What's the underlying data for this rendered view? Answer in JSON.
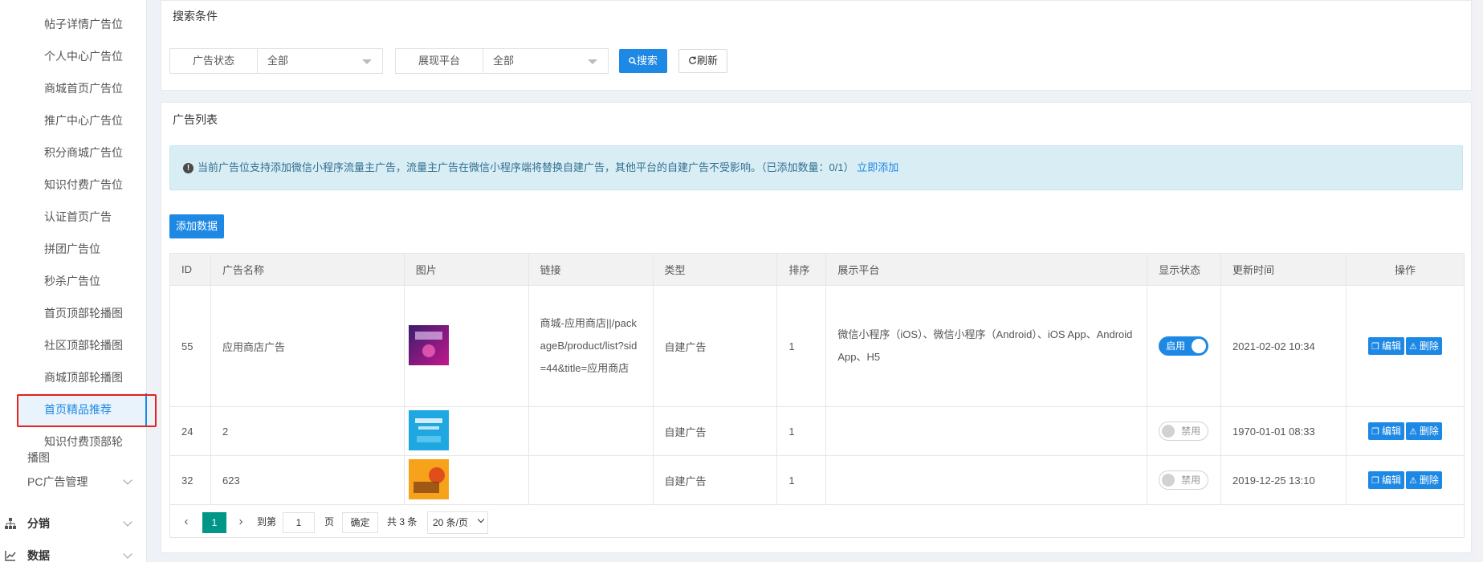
{
  "sidebar": {
    "items": [
      {
        "label": "帖子详情广告位"
      },
      {
        "label": "个人中心广告位"
      },
      {
        "label": "商城首页广告位"
      },
      {
        "label": "推广中心广告位"
      },
      {
        "label": "积分商城广告位"
      },
      {
        "label": "知识付费广告位"
      },
      {
        "label": "认证首页广告"
      },
      {
        "label": "拼团广告位"
      },
      {
        "label": "秒杀广告位"
      },
      {
        "label": "首页顶部轮播图"
      },
      {
        "label": "社区顶部轮播图"
      },
      {
        "label": "商城顶部轮播图"
      },
      {
        "label": "首页精品推荐",
        "active": true
      }
    ],
    "two_line_item": {
      "line1": "知识付费顶部轮",
      "line2": "播图"
    },
    "pc_item": "PC广告管理",
    "groups": [
      {
        "label": "分销",
        "icon": "sitemap-icon"
      },
      {
        "label": "数据",
        "icon": "line-chart-icon"
      }
    ]
  },
  "search": {
    "title": "搜索条件",
    "status_label": "广告状态",
    "status_value": "全部",
    "platform_label": "展现平台",
    "platform_value": "全部",
    "search_button": "搜索",
    "refresh_button": "刷新"
  },
  "list": {
    "title": "广告列表",
    "notice_text": "当前广告位支持添加微信小程序流量主广告，流量主广告在微信小程序端将替换自建广告，其他平台的自建广告不受影响。（已添加数量：0/1）",
    "notice_link": "立即添加",
    "add_button": "添加数据",
    "columns": [
      "ID",
      "广告名称",
      "图片",
      "链接",
      "类型",
      "排序",
      "展示平台",
      "显示状态",
      "更新时间",
      "操作"
    ],
    "rows": [
      {
        "id": "55",
        "name": "应用商店广告",
        "link": "商城-应用商店||/packageB/product/list?sid=44&title=应用商店",
        "type": "自建广告",
        "sort": "1",
        "platform": "微信小程序（iOS）、微信小程序（Android）、iOS App、Android App、H5",
        "status": "启用",
        "status_on": true,
        "updated": "2021-02-02 10:34",
        "thumb_colors": [
          "#3a1c6e",
          "#c2188c"
        ]
      },
      {
        "id": "24",
        "name": "2",
        "link": "",
        "type": "自建广告",
        "sort": "1",
        "platform": "",
        "status": "禁用",
        "status_on": false,
        "updated": "1970-01-01 08:33",
        "thumb_colors": [
          "#1ea7e0",
          "#59c3ef"
        ]
      },
      {
        "id": "32",
        "name": "623",
        "link": "",
        "type": "自建广告",
        "sort": "1",
        "platform": "",
        "status": "禁用",
        "status_on": false,
        "updated": "2019-12-25 13:10",
        "thumb_colors": [
          "#f7a21b",
          "#e04e1b"
        ]
      }
    ],
    "edit_label": "编辑",
    "delete_label": "删除"
  },
  "pagination": {
    "current_page": "1",
    "goto_label": "到第",
    "goto_value": "1",
    "page_suffix": "页",
    "confirm": "确定",
    "total": "共 3 条",
    "page_size": "20 条/页"
  },
  "colors": {
    "accent": "#1e88e5",
    "pager_active": "#009688",
    "highlight_box": "#e32222"
  }
}
